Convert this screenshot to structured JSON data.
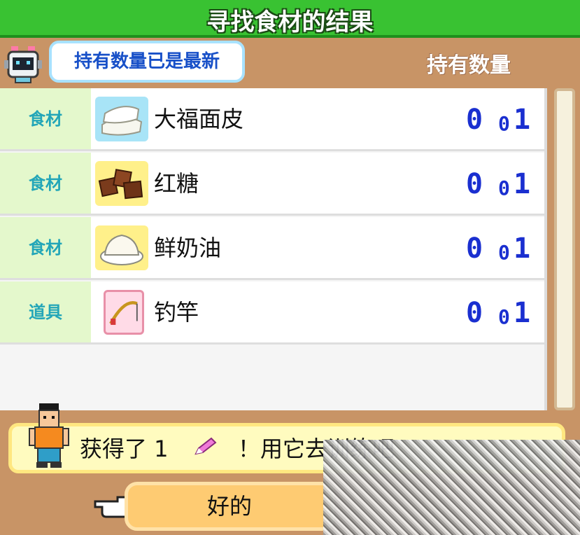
{
  "title": "寻找食材的结果",
  "status_bubble": "持有数量已是最新",
  "column_header": "持有数量",
  "items": [
    {
      "category": "食材",
      "name": "大福面皮",
      "digit_a": "0",
      "digit_b": "0",
      "digit_c": "1",
      "icon": "daifuku-wrapper-icon",
      "icon_bg": "#a8e4f7"
    },
    {
      "category": "食材",
      "name": "红糖",
      "digit_a": "0",
      "digit_b": "0",
      "digit_c": "1",
      "icon": "brown-sugar-icon",
      "icon_bg": "#fff08a"
    },
    {
      "category": "食材",
      "name": "鲜奶油",
      "digit_a": "0",
      "digit_b": "0",
      "digit_c": "1",
      "icon": "fresh-cream-icon",
      "icon_bg": "#fff08a"
    },
    {
      "category": "道具",
      "name": "钓竿",
      "digit_a": "0",
      "digit_b": "0",
      "digit_c": "1",
      "icon": "fishing-rod-icon",
      "icon_bg": "#ffdbe7"
    }
  ],
  "message": {
    "part1": "获得了 1",
    "icon": "pencil-icon",
    "part2": "！用它去训练吧"
  },
  "confirm_button": "好的",
  "colors": {
    "title_bar": "#39c232",
    "category_bg": "#e4f8cc",
    "digit_color": "#1a2fd0"
  }
}
